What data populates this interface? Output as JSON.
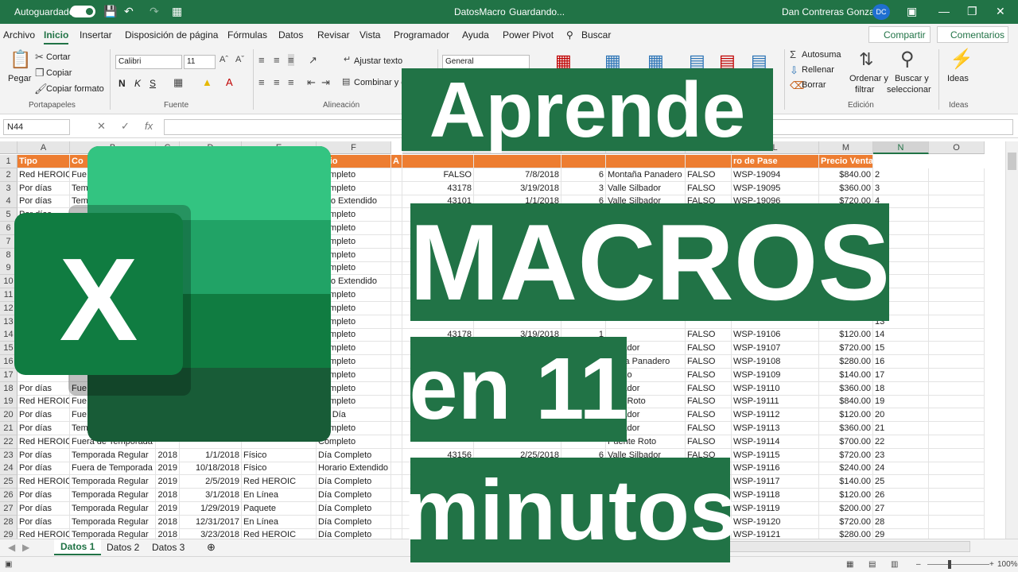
{
  "titlebar": {
    "autosave": "Autoguardado",
    "filename": "DatosMacro",
    "status": "Guardando...",
    "user": "Dan Contreras Gonzalez",
    "initials": "DC"
  },
  "menu": [
    "Archivo",
    "Inicio",
    "Insertar",
    "Disposición de página",
    "Fórmulas",
    "Datos",
    "Revisar",
    "Vista",
    "Programador",
    "Ayuda",
    "Power Pivot"
  ],
  "search": "Buscar",
  "share": "Compartir",
  "comments": "Comentarios",
  "ribbon": {
    "paste": "Pegar",
    "cut": "Cortar",
    "copy": "Copiar",
    "format_painter": "Copiar formato",
    "clipboard": "Portapapeles",
    "font_name": "Calibri",
    "font_size": "11",
    "bold": "N",
    "italic": "K",
    "underline": "S",
    "font": "Fuente",
    "wrap": "Ajustar texto",
    "merge": "Combinar y c",
    "alignment": "Alineación",
    "number_format": "General",
    "autosum": "Autosuma",
    "fill": "Rellenar",
    "clear": "Borrar",
    "sort_1": "Ordenar y",
    "sort_2": "filtrar",
    "find_1": "Buscar y",
    "find_2": "seleccionar",
    "editing": "Edición",
    "ideas": "Ideas",
    "ideas_group": "Ideas"
  },
  "namebox": "N44",
  "fx": "fx",
  "columns": [
    "A",
    "B",
    "C",
    "D",
    "E",
    "F",
    "G",
    "H",
    "I",
    "J",
    "K",
    "L",
    "M",
    "N",
    "O"
  ],
  "headers": {
    "a": "Tipo",
    "b": "Co",
    "f": "rario",
    "g": "A",
    "l": "ro de Pase",
    "m": "Precio Venta"
  },
  "rows": [
    {
      "n": "2",
      "a": "Red HEROIC",
      "b": "Fue",
      "f": "Completo",
      "h": "FALSO",
      "i": "7/8/2018",
      "j": "6",
      "k": "Montaña Panadero",
      "kk": "FALSO",
      "l": "WSP-19094",
      "m": "$840.00"
    },
    {
      "n": "3",
      "a": "Por días",
      "b": "Tem",
      "f": "Completo",
      "h": "43178",
      "i": "3/19/2018",
      "j": "3",
      "k": "Valle Silbador",
      "kk": "FALSO",
      "l": "WSP-19095",
      "m": "$360.00"
    },
    {
      "n": "4",
      "a": "Por días",
      "b": "Tem",
      "f": "rario Extendido",
      "h": "43101",
      "i": "1/1/2018",
      "j": "6",
      "k": "Valle Silbador",
      "kk": "FALSO",
      "l": "WSP-19096",
      "m": "$720.00"
    },
    {
      "n": "5",
      "a": "Por días",
      "b": "",
      "f": "Completo",
      "h": "",
      "i": "",
      "j": "",
      "k": "",
      "kk": "",
      "l": "",
      "m": ""
    },
    {
      "n": "6",
      "a": "",
      "b": "",
      "f": "Completo",
      "h": "",
      "i": "",
      "j": "",
      "k": "",
      "kk": "",
      "l": "",
      "m": ""
    },
    {
      "n": "7",
      "a": "",
      "b": "",
      "f": "Completo",
      "h": "",
      "i": "",
      "j": "",
      "k": "",
      "kk": "",
      "l": "",
      "m": ""
    },
    {
      "n": "8",
      "a": "",
      "b": "",
      "f": "Completo",
      "h": "",
      "i": "",
      "j": "",
      "k": "",
      "kk": "",
      "l": "",
      "m": ""
    },
    {
      "n": "9",
      "a": "",
      "b": "",
      "f": "Completo",
      "h": "",
      "i": "",
      "j": "",
      "k": "",
      "kk": "",
      "l": "",
      "m": ""
    },
    {
      "n": "10",
      "a": "",
      "b": "",
      "f": "rario Extendido",
      "h": "",
      "i": "",
      "j": "",
      "k": "",
      "kk": "",
      "l": "",
      "m": ""
    },
    {
      "n": "11",
      "a": "",
      "b": "",
      "f": "Completo",
      "h": "",
      "i": "",
      "j": "",
      "k": "",
      "kk": "",
      "l": "",
      "m": ""
    },
    {
      "n": "12",
      "a": "",
      "b": "",
      "f": "Completo",
      "h": "",
      "i": "",
      "j": "",
      "k": "",
      "kk": "",
      "l": "",
      "m": ""
    },
    {
      "n": "13",
      "a": "",
      "b": "",
      "f": "Completo",
      "h": "",
      "i": "",
      "j": "",
      "k": "",
      "kk": "",
      "l": "",
      "m": ""
    },
    {
      "n": "14",
      "a": "",
      "b": "",
      "f": "Completo",
      "h": "43178",
      "i": "3/19/2018",
      "j": "1",
      "k": "",
      "kk": "FALSO",
      "l": "WSP-19106",
      "m": "$120.00"
    },
    {
      "n": "15",
      "a": "",
      "b": "",
      "f": "Completo",
      "h": "",
      "i": "",
      "j": "",
      "k": "Silbador",
      "kk": "FALSO",
      "l": "WSP-19107",
      "m": "$720.00"
    },
    {
      "n": "16",
      "a": "",
      "b": "",
      "f": "Completo",
      "h": "",
      "i": "",
      "j": "",
      "k": "ntaña Panadero",
      "kk": "FALSO",
      "l": "WSP-19108",
      "m": "$280.00"
    },
    {
      "n": "17",
      "a": "",
      "b": "",
      "f": "Completo",
      "h": "",
      "i": "",
      "j": "",
      "k": "a Velo",
      "kk": "FALSO",
      "l": "WSP-19109",
      "m": "$140.00"
    },
    {
      "n": "18",
      "a": "Por días",
      "b": "Fue",
      "f": "Completo",
      "h": "",
      "i": "",
      "j": "",
      "k": "Silbador",
      "kk": "FALSO",
      "l": "WSP-19110",
      "m": "$360.00"
    },
    {
      "n": "19",
      "a": "Red HEROIC",
      "b": "Fue",
      "f": "Completo",
      "h": "",
      "i": "",
      "j": "",
      "k": "ente Roto",
      "kk": "FALSO",
      "l": "WSP-19111",
      "m": "$840.00"
    },
    {
      "n": "20",
      "a": "Por días",
      "b": "Fue",
      "f": "dio Día",
      "h": "",
      "i": "",
      "j": "",
      "k": "Silbador",
      "kk": "FALSO",
      "l": "WSP-19112",
      "m": "$120.00"
    },
    {
      "n": "21",
      "a": "Por días",
      "b": "Tem",
      "f": "Completo",
      "h": "",
      "i": "",
      "j": "",
      "k": "Silbador",
      "kk": "FALSO",
      "l": "WSP-19113",
      "m": "$360.00"
    },
    {
      "n": "22",
      "a": "Red HEROIC",
      "b": "Fuera de Temporada",
      "f": "Completo",
      "h": "",
      "i": "",
      "j": "",
      "k": "Puente Roto",
      "kk": "FALSO",
      "l": "WSP-19114",
      "m": "$700.00"
    },
    {
      "n": "23",
      "a": "Por días",
      "b": "Temporada Regular",
      "c": "2018",
      "d": "1/1/2018",
      "e": "Físico",
      "f": "Día Completo",
      "h": "43156",
      "i": "2/25/2018",
      "j": "6",
      "k": "Valle Silbador",
      "kk": "FALSO",
      "l": "WSP-19115",
      "m": "$720.00"
    },
    {
      "n": "24",
      "a": "Por días",
      "b": "Fuera de Temporada",
      "c": "2019",
      "d": "10/18/2018",
      "e": "Físico",
      "f": "Horario Extendido",
      "h": "",
      "i": "",
      "j": "",
      "k": "",
      "kk": "",
      "l": "WSP-19116",
      "m": "$240.00"
    },
    {
      "n": "25",
      "a": "Red HEROIC",
      "b": "Temporada Regular",
      "c": "2019",
      "d": "2/5/2019",
      "e": "Red HEROIC",
      "f": "Día Completo",
      "h": "",
      "i": "",
      "j": "",
      "k": "",
      "kk": "",
      "l": "WSP-19117",
      "m": "$140.00"
    },
    {
      "n": "26",
      "a": "Por días",
      "b": "Temporada Regular",
      "c": "2018",
      "d": "3/1/2018",
      "e": "En Línea",
      "f": "Día Completo",
      "h": "",
      "i": "",
      "j": "",
      "k": "",
      "kk": "",
      "l": "WSP-19118",
      "m": "$120.00"
    },
    {
      "n": "27",
      "a": "Por días",
      "b": "Temporada Regular",
      "c": "2019",
      "d": "1/29/2019",
      "e": "Paquete",
      "f": "Día Completo",
      "h": "",
      "i": "",
      "j": "",
      "k": "",
      "kk": "otel",
      "l": "WSP-19119",
      "m": "$200.00"
    },
    {
      "n": "28",
      "a": "Por días",
      "b": "Temporada Regular",
      "c": "2018",
      "d": "12/31/2017",
      "e": "En Línea",
      "f": "Día Completo",
      "h": "",
      "i": "",
      "j": "",
      "k": "",
      "kk": "",
      "l": "WSP-19120",
      "m": "$720.00"
    },
    {
      "n": "29",
      "a": "Red HEROIC",
      "b": "Temporada Regular",
      "c": "2018",
      "d": "3/23/2018",
      "e": "Red HEROIC",
      "f": "Día Completo",
      "h": "",
      "i": "",
      "j": "",
      "k": "",
      "kk": "",
      "l": "WSP-19121",
      "m": "$280.00"
    }
  ],
  "sheets": [
    "Datos 1",
    "Datos 2",
    "Datos 3"
  ],
  "zoom": "100%",
  "banner": {
    "line1": "Aprende",
    "line2": "MACROS",
    "line3": "en 11",
    "line4": "minutos"
  },
  "logo_letter": "X",
  "colors": {
    "excel_green": "#217346",
    "header_orange": "#ed7d31"
  }
}
